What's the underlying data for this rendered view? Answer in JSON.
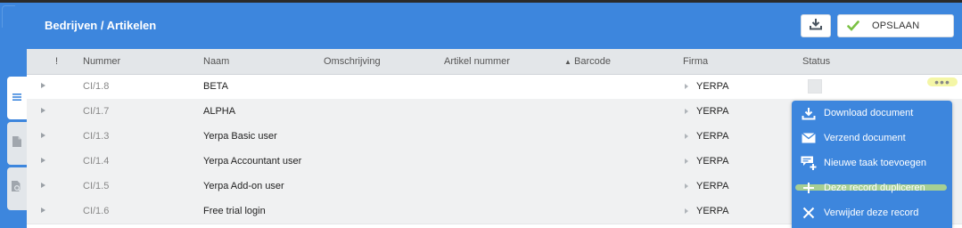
{
  "header": {
    "title": "Bedrijven / Artikelen",
    "download_icon": "download-icon",
    "save_label": "OPSLAAN",
    "save_icon": "checkmark-icon",
    "accent_color": "#3d86dd",
    "check_color": "#7ac143"
  },
  "sidetabs": [
    {
      "icon": "list-icon",
      "active": true
    },
    {
      "icon": "document-icon",
      "active": false
    },
    {
      "icon": "document-search-icon",
      "active": false
    }
  ],
  "table": {
    "columns": [
      "!",
      "Nummer",
      "Naam",
      "Omschrijving",
      "Artikel nummer",
      "Barcode",
      "Firma",
      "Status"
    ],
    "sort_indicator": "▲",
    "rows": [
      {
        "nummer": "CI/1.8",
        "naam": "BETA",
        "firma": "YERPA"
      },
      {
        "nummer": "CI/1.7",
        "naam": "ALPHA",
        "firma": "YERPA"
      },
      {
        "nummer": "CI/1.3",
        "naam": "Yerpa Basic user",
        "firma": "YERPA"
      },
      {
        "nummer": "CI/1.4",
        "naam": "Yerpa Accountant user",
        "firma": "YERPA"
      },
      {
        "nummer": "CI/1.5",
        "naam": "Yerpa Add-on user",
        "firma": "YERPA"
      },
      {
        "nummer": "CI/1.6",
        "naam": "Free trial login",
        "firma": "YERPA"
      }
    ],
    "more_button": "•••"
  },
  "context_menu": {
    "items": [
      {
        "label": "Download document",
        "icon": "download-icon"
      },
      {
        "label": "Verzend document",
        "icon": "envelope-icon"
      },
      {
        "label": "Nieuwe taak toevoegen",
        "icon": "add-task-icon"
      },
      {
        "label": "Deze record dupliceren",
        "icon": "plus-icon"
      },
      {
        "label": "Verwijder deze record",
        "icon": "close-icon"
      }
    ]
  }
}
